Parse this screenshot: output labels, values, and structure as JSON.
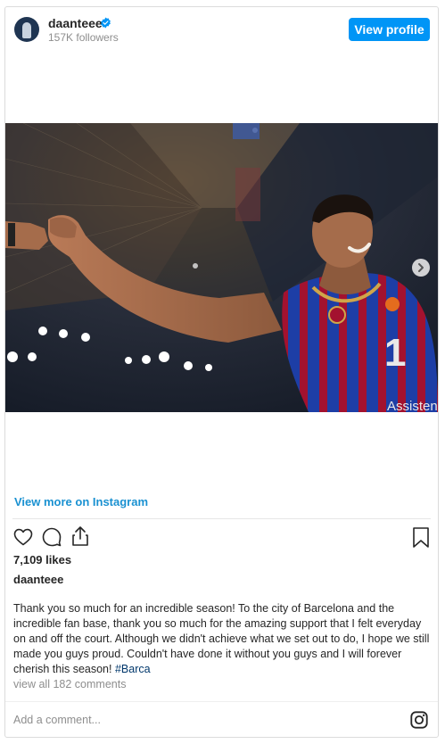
{
  "header": {
    "username": "daanteee",
    "followers": "157K followers",
    "view_profile_label": "View profile"
  },
  "post": {
    "view_more_label": "View more on Instagram",
    "likes": "7,109 likes",
    "caption_user": "daanteee",
    "caption_text": "Thank you so much for an incredible season! To the city of Barcelona and the incredible fan base, thank you so much for the amazing support that I felt everyday on and off the court. Although we didn't achieve what we set out to do, I hope we still made you guys proud. Couldn't have done it without you guys and I will forever cherish this season! ",
    "hashtag": "#Barca",
    "comments_link": "view all 182 comments",
    "comment_placeholder": "Add a comment..."
  },
  "photo": {
    "jersey_number": "1",
    "sponsor_text": "Assistenc"
  },
  "colors": {
    "accent": "#0095f6",
    "link": "#1a91d1",
    "jersey_blue": "#1d3ea6",
    "jersey_red": "#a3122f"
  },
  "icons": [
    "verified-badge-icon",
    "heart-icon",
    "comment-icon",
    "share-icon",
    "bookmark-icon",
    "instagram-icon",
    "chevron-right-icon"
  ]
}
